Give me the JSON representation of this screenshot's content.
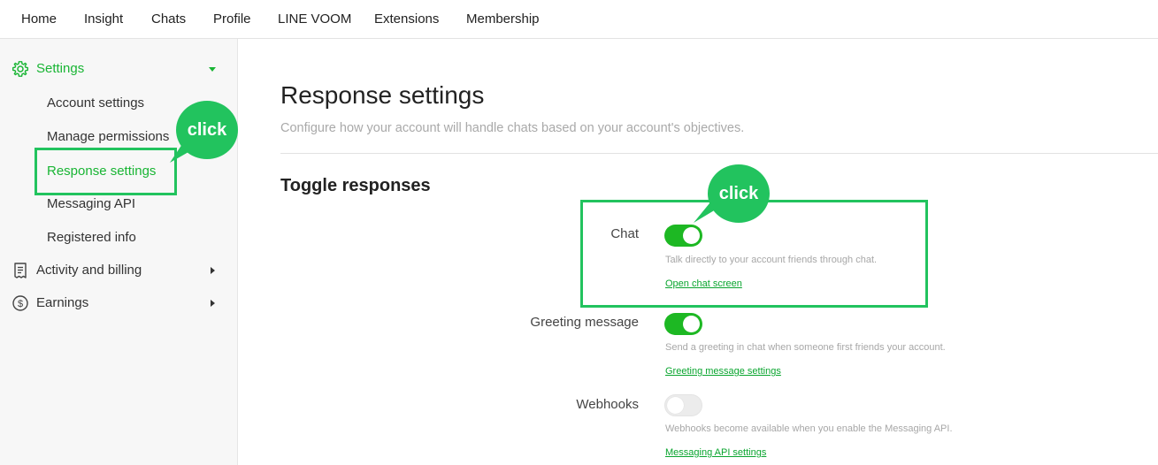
{
  "topnav": {
    "items": [
      "Home",
      "Insight",
      "Chats",
      "Profile",
      "LINE VOOM",
      "Extensions",
      "Membership"
    ]
  },
  "sidebar": {
    "settings": {
      "label": "Settings",
      "icon": "gear-icon"
    },
    "sub_items": [
      "Account settings",
      "Manage permissions",
      "Response settings",
      "Messaging API",
      "Registered info"
    ],
    "active_sub": "Response settings",
    "activity": {
      "label": "Activity and billing",
      "icon": "receipt-icon"
    },
    "earnings": {
      "label": "Earnings",
      "icon": "dollar-coin-icon"
    }
  },
  "annotations": {
    "click_label_1": "click",
    "click_label_2": "click"
  },
  "main": {
    "title": "Response settings",
    "description": "Configure how your account will handle chats based on your account's objectives.",
    "section_title": "Toggle responses",
    "responses": [
      {
        "label": "Chat",
        "enabled": true,
        "description": "Talk directly to your account friends through chat.",
        "link": "Open chat screen"
      },
      {
        "label": "Greeting message",
        "enabled": true,
        "description": "Send a greeting in chat when someone first friends your account.",
        "link": "Greeting message settings"
      },
      {
        "label": "Webhooks",
        "enabled": false,
        "description": "Webhooks become available when you enable the Messaging API.",
        "link": "Messaging API settings"
      }
    ]
  },
  "colors": {
    "accent": "#19b534",
    "toggle_on": "#1db823",
    "highlight": "#22c35e"
  }
}
